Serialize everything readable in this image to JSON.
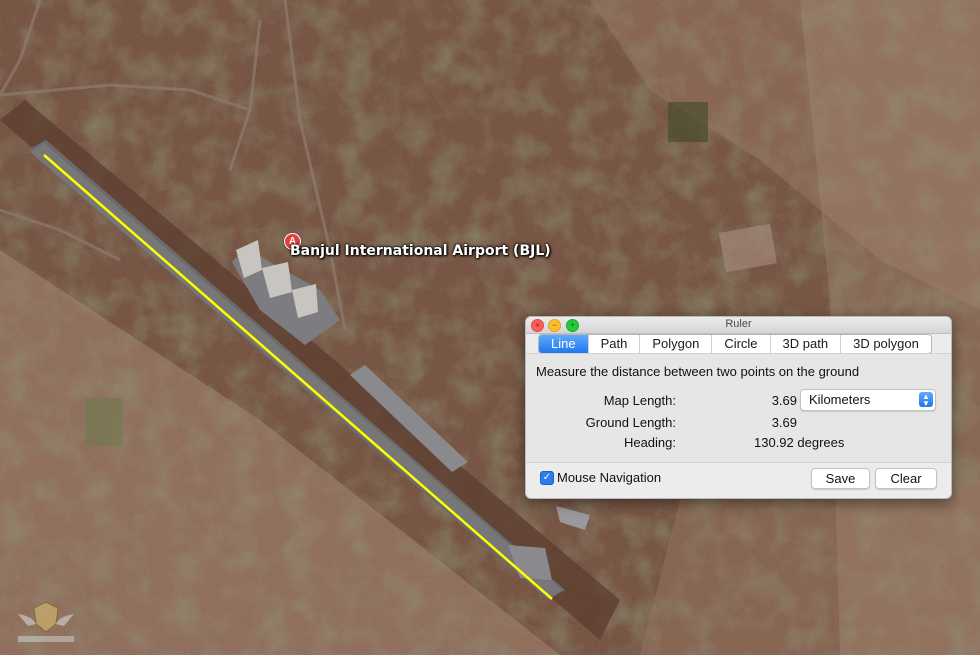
{
  "map": {
    "place_pin_letter": "A",
    "place_label": "Banjul International Airport (BJL)",
    "measure_line_color": "#ffff00"
  },
  "ruler": {
    "window_title": "Ruler",
    "tabs": [
      {
        "label": "Line",
        "active": true
      },
      {
        "label": "Path",
        "active": false
      },
      {
        "label": "Polygon",
        "active": false
      },
      {
        "label": "Circle",
        "active": false
      },
      {
        "label": "3D path",
        "active": false
      },
      {
        "label": "3D polygon",
        "active": false
      }
    ],
    "description": "Measure the distance between two points on the ground",
    "map_length_label": "Map Length:",
    "map_length_value": "3.69",
    "unit_selected": "Kilometers",
    "ground_length_label": "Ground Length:",
    "ground_length_value": "3.69",
    "heading_label": "Heading:",
    "heading_value": "130.92 degrees",
    "mouse_navigation_label": "Mouse Navigation",
    "mouse_navigation_checked": true,
    "save_label": "Save",
    "clear_label": "Clear"
  }
}
